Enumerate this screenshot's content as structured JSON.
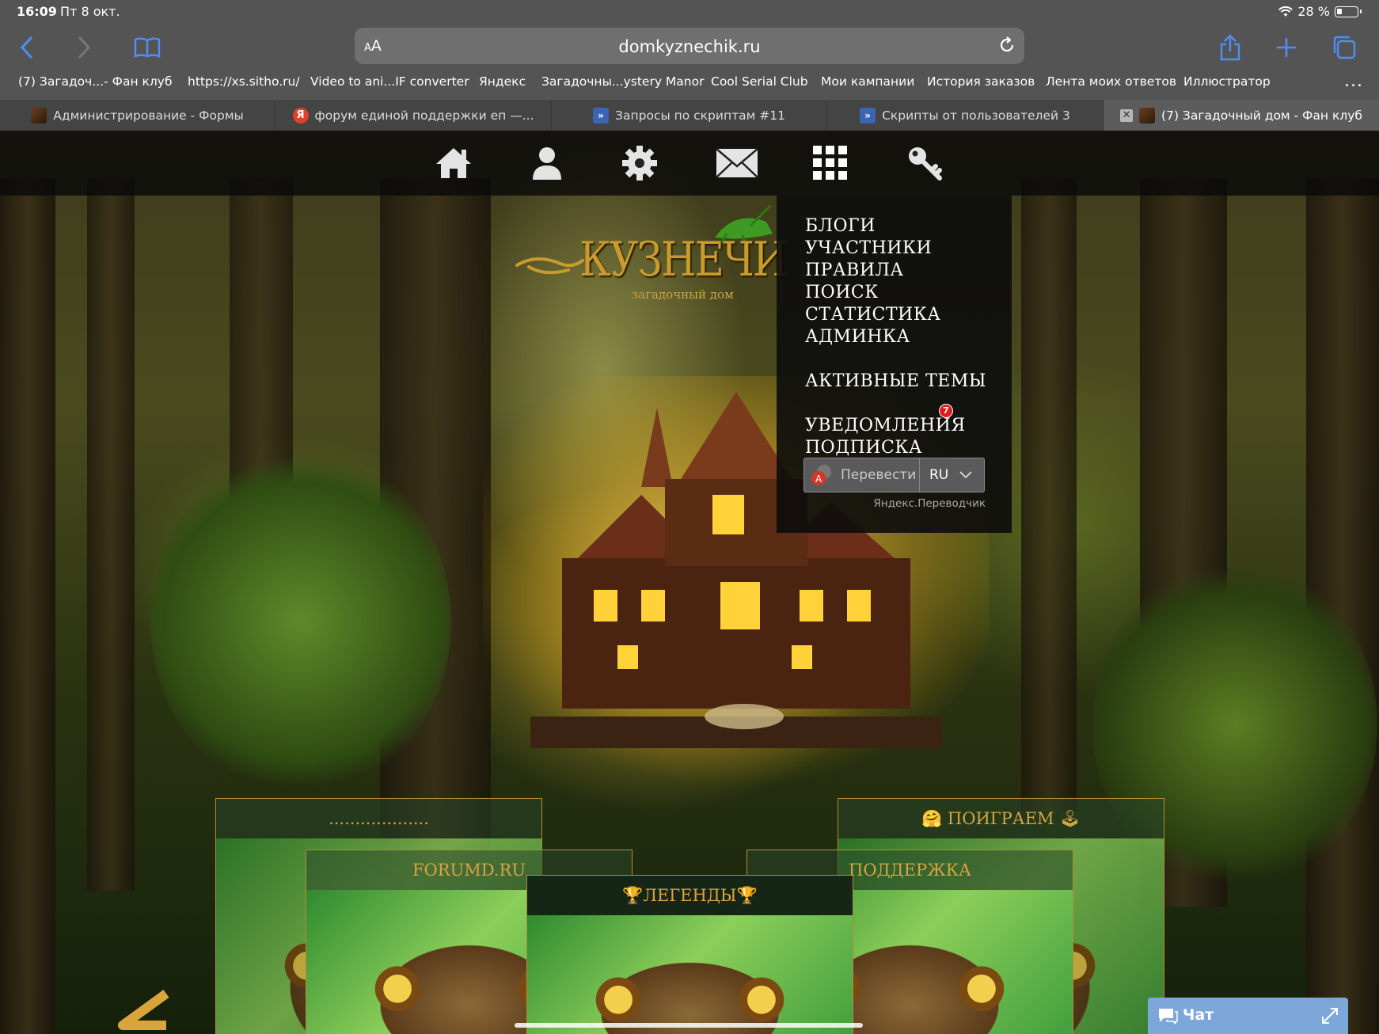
{
  "status_bar": {
    "time": "16:09",
    "date": "Пт 8 окт.",
    "battery": "28 %"
  },
  "browser": {
    "url": "domkyznechik.ru",
    "reader_label_small": "A",
    "reader_label_big": "A",
    "bookmarks": [
      "(7) Загадоч...- Фан клуб",
      "https://xs.sitho.ru/",
      "Video to ani...IF converter",
      "Яндекс",
      "Загадочны...ystery Manor",
      "Cool Serial Club",
      "Мои кампании",
      "История заказов",
      "Лента моих ответов",
      "Иллюстратор"
    ],
    "bookmarks_more": "...",
    "tabs": [
      {
        "label": "Администрирование - Формы",
        "favicon": "forum-image-icon"
      },
      {
        "label": "форум единой поддержки еп —...",
        "favicon": "yandex-icon"
      },
      {
        "label": "Запросы по скриптам #11",
        "favicon": "scripts-icon"
      },
      {
        "label": "Скрипты от пользователей 3",
        "favicon": "scripts-icon"
      },
      {
        "label": "(7) Загадочный дом - Фан клуб",
        "favicon": "forum-image-icon",
        "active": true
      }
    ],
    "tab_close": "✕"
  },
  "site": {
    "nav_icons": [
      "home-icon",
      "user-icon",
      "gear-icon",
      "mail-icon",
      "grid-menu-icon",
      "key-icon"
    ],
    "logo": {
      "title": "КУЗНЕЧИ",
      "subtitle": "загадочный дом"
    },
    "dropdown": {
      "items": [
        "БЛОГИ",
        "УЧАСТНИКИ",
        "ПРАВИЛА",
        "ПОИСК",
        "СТАТИСТИКА",
        "АДМИНКА"
      ],
      "active_topics": "АКТИВНЫЕ ТЕМЫ",
      "notifications": "УВЕДОМЛЕНИЯ",
      "notifications_count": "7",
      "subscription": "ПОДПИСКА",
      "translate_button": "Перевести",
      "translate_lang": "RU",
      "translate_credit": "Яндекс.Переводчик"
    },
    "cards": [
      {
        "title": "..................."
      },
      {
        "title": "🤗 ПОИГРАЕМ 🕹"
      },
      {
        "title": "FORUMD.RU"
      },
      {
        "title": "ПОДДЕРЖКА"
      },
      {
        "title": "🏆ЛЕГЕНДЫ🏆"
      }
    ],
    "chat": {
      "label": "Чат"
    }
  },
  "colors": {
    "accent_gold": "#d7a342",
    "chrome_bg": "#545454",
    "url_bar_bg": "#6f6f6f",
    "ios_blue": "#4f8ef7",
    "chat_blue": "#7da7d9",
    "badge_red": "#e01b1b"
  }
}
